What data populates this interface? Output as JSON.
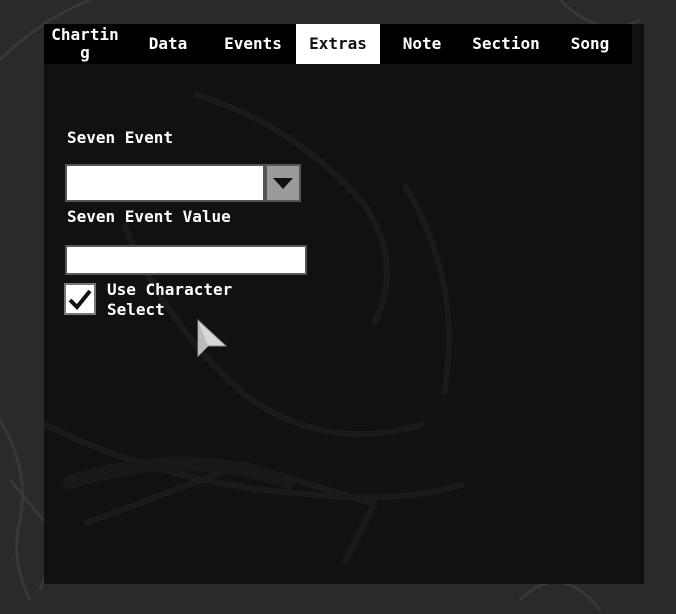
{
  "tabs": [
    {
      "label": "Chartin\ng",
      "active": false
    },
    {
      "label": "Data",
      "active": false
    },
    {
      "label": "Events",
      "active": false
    },
    {
      "label": "Extras",
      "active": true
    },
    {
      "label": "Note",
      "active": false
    },
    {
      "label": "Section",
      "active": false
    },
    {
      "label": "Song",
      "active": false
    }
  ],
  "extras": {
    "seven_event_label": "Seven Event",
    "seven_event_selected": "",
    "seven_event_value_label": "Seven Event Value",
    "seven_event_value": "",
    "use_character_select_label": "Use Character Select",
    "use_character_select_checked": true
  },
  "icons": {
    "dropdown_arrow": "chevron-down-icon",
    "checkbox_mark": "check-icon",
    "cursor": "pointer-cursor-icon"
  },
  "colors": {
    "panel_bg": "#111111",
    "tab_bar_bg": "#000000",
    "active_tab_bg": "#ffffff",
    "page_bg": "#2a2a2a"
  }
}
